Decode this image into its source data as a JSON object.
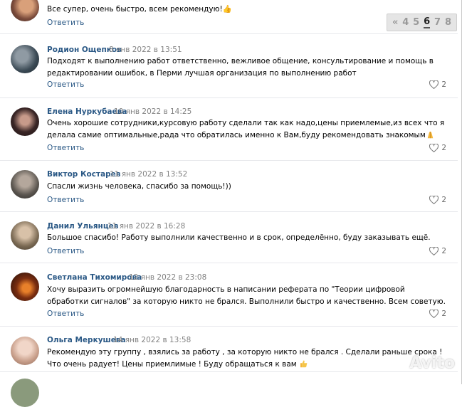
{
  "pagination": {
    "items": [
      "«",
      "4",
      "5",
      "6",
      "7",
      "8"
    ],
    "current": "6"
  },
  "reply_label": "Ответить",
  "comments": [
    {
      "text": "Все супер, очень быстро, всем рекомендую!👍",
      "likes": ""
    },
    {
      "author": "Родион Ощепков",
      "date": "8 янв 2022 в 13:51",
      "text": "Подходят к выполнению работ ответственно, вежливое общение, консультирование и помощь в редактировании ошибок, в Перми лучшая организация по выполнению работ",
      "likes": "2"
    },
    {
      "author": "Елена Нуркубаева",
      "date": "10 янв 2022 в 14:25",
      "text": "Очень хорошие сотрудники,курсовую работу сделали так как надо,цены приемлемые,из всех что я делала самие оптимальные,рада что обратилась именно к Вам,буду рекомендовать знакомым",
      "likes": "2"
    },
    {
      "author": "Виктор Костарев",
      "date": "11 янв 2022 в 13:52",
      "text": "Спасли жизнь человека, спасибо за помощь!))",
      "likes": "2"
    },
    {
      "author": "Данил Ульянцев",
      "date": "11 янв 2022 в 16:28",
      "text": "Большое спасибо! Работу выполнили качественно и в срок, определённо, буду заказывать ещё.",
      "likes": "2"
    },
    {
      "author": "Светлана Тихомирова",
      "date": "12 янв 2022 в 23:08",
      "text": "Хочу выразить огромнейшую благодарность в написании реферата по \"Теории цифровой обработки сигналов\" за которую никто не брался. Выполнили быстро и качественно. Всем советую.",
      "likes": "2"
    },
    {
      "author": "Ольга Меркушева",
      "date": "14 янв 2022 в 13:58",
      "text": "Рекомендую эту группу , взялись за работу , за которую никто не брался . Сделали раньше срока ! Что очень радует! Цены приемлимые ! Буду обращаться к вам",
      "likes": ""
    }
  ],
  "watermark": "Avito"
}
